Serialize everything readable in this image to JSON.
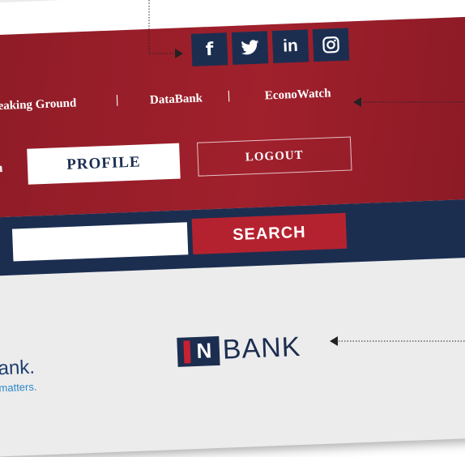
{
  "social": {
    "facebook": "f",
    "twitter": "t",
    "linkedin": "in",
    "instagram": "◎"
  },
  "nav": {
    "items": [
      "Breaking Ground",
      "DataBank",
      "EconoWatch"
    ],
    "separator": "|"
  },
  "account": {
    "label_fragment": "om",
    "profile_label": "PROFILE",
    "logout_label": "LOGOUT"
  },
  "search": {
    "value": "",
    "button_label": "SEARCH"
  },
  "sponsors": {
    "left_name_fragment": "ank.",
    "left_tagline_fragment": "matters.",
    "inbank_mark": "N",
    "inbank_word": "BANK"
  },
  "colors": {
    "brand_red": "#9b1f2b",
    "navy": "#1c2e50",
    "search_red": "#b5222f"
  }
}
